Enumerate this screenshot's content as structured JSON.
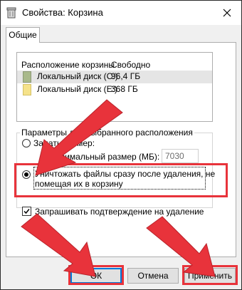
{
  "window": {
    "title": "Свойства: Корзина"
  },
  "tabs": [
    {
      "label": "Общие"
    }
  ],
  "recycle_list": {
    "headers": {
      "location": "Расположение корзины",
      "free": "Свободно"
    },
    "rows": [
      {
        "location": "Локальный диск (C:)",
        "free": "96,4 ГБ",
        "icon": "hdd-system-icon"
      },
      {
        "location": "Локальный диск (E:)",
        "free": "368 ГБ",
        "icon": "hdd-icon"
      }
    ]
  },
  "settings_group": {
    "title": "Параметры для выбранного расположения",
    "custom_size_label": "Задать размер:",
    "max_size_label": "Максимальный размер (МБ):",
    "max_size_value": "7030",
    "delete_immediately_label_line1": "Уничтожать файлы сразу после удаления, не",
    "delete_immediately_label_line2": "помещая их в корзину",
    "custom_size_selected": false,
    "delete_immediately_selected": true
  },
  "confirm_delete": {
    "label": "Запрашивать подтверждение на удаление",
    "checked": true
  },
  "buttons": {
    "ok": "ОК",
    "cancel": "Отмена",
    "apply": "Применить"
  },
  "colors": {
    "highlight": "#e8333b",
    "ok_border": "#0078d7"
  }
}
